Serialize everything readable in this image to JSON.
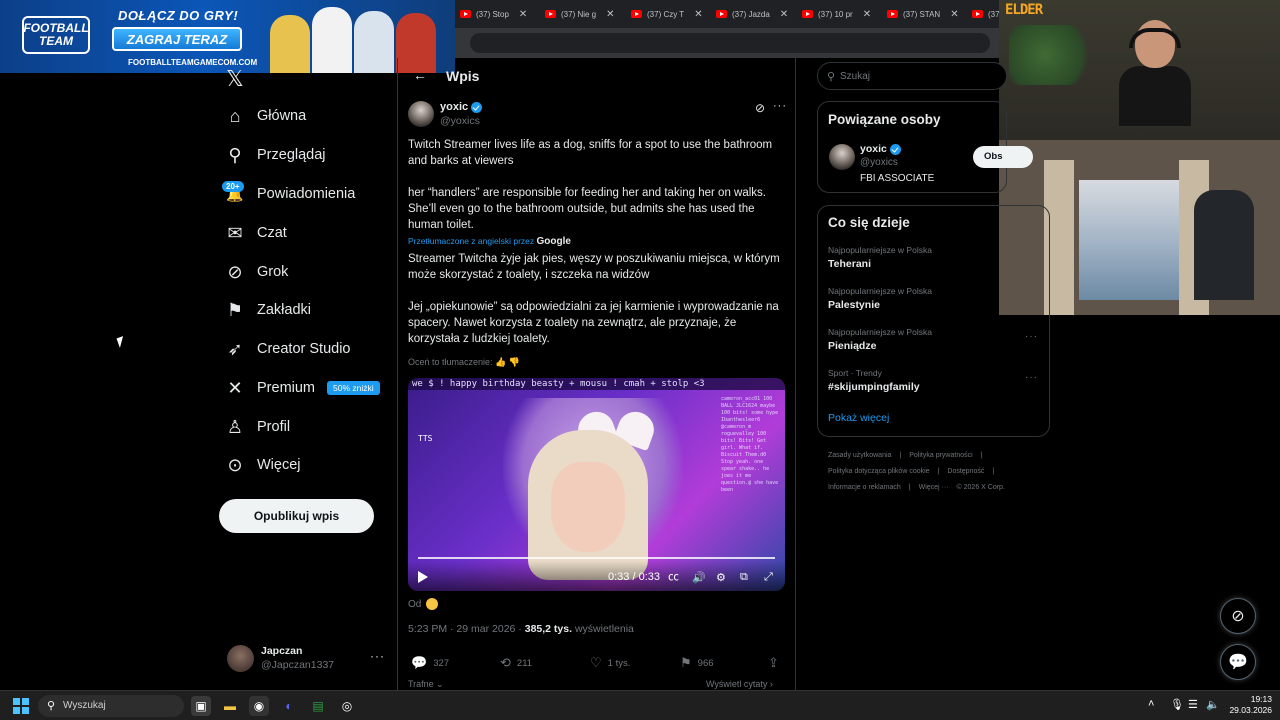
{
  "browser": {
    "tabs": [
      "(37) Stop",
      "(37) Nie g",
      "(37) Czy T",
      "(37) Jazda",
      "(37) 10 pr",
      "(37) STAN",
      "(37)"
    ]
  },
  "ad": {
    "logo_line1": "FOOTBALL",
    "logo_line2": "TEAM",
    "headline": "DOŁĄCZ DO GRY!",
    "cta": "ZAGRAJ TERAZ",
    "site": "FOOTBALLTEAMGAMECOM.COM"
  },
  "webcam": {
    "tag": "ELDER"
  },
  "nav": {
    "logo": "𝕏",
    "items": [
      {
        "label": "Główna",
        "icon": "home-icon",
        "glyph": "⌂"
      },
      {
        "label": "Przeglądaj",
        "icon": "search-icon",
        "glyph": "⚲"
      },
      {
        "label": "Powiadomienia",
        "icon": "bell-icon",
        "glyph": "🔔"
      },
      {
        "label": "Czat",
        "icon": "mail-icon",
        "glyph": "✉"
      },
      {
        "label": "Grok",
        "icon": "grok-icon",
        "glyph": "⊘"
      },
      {
        "label": "Zakładki",
        "icon": "bookmark-icon",
        "glyph": "⚑"
      },
      {
        "label": "Creator Studio",
        "icon": "rocket-icon",
        "glyph": "➶"
      },
      {
        "label": "Premium",
        "icon": "x-premium-icon",
        "glyph": "✕"
      },
      {
        "label": "Profil",
        "icon": "person-icon",
        "glyph": "♙"
      },
      {
        "label": "Więcej",
        "icon": "more-circle-icon",
        "glyph": "⊙"
      }
    ],
    "notif_badge": "20+",
    "premium_badge": "50% zniżki",
    "post_button": "Opublikuj wpis",
    "account": {
      "name": "Japczan",
      "handle": "@Japczan1337",
      "more": "···"
    }
  },
  "post": {
    "back": "←",
    "header": "Wpis",
    "author": {
      "name": "yoxic",
      "handle": "@yoxics"
    },
    "original_p1": "Twitch Streamer lives life as a dog, sniffs for a spot to use the bathroom and barks at viewers",
    "original_p2": "her “handlers” are responsible for feeding her and taking her on walks. She’ll even go to the bathroom outside, but admits she has used the human toilet.",
    "translated_by": "Przetłumaczone z angielski przez",
    "translator": "Google",
    "translated_p1": "Streamer Twitcha żyje jak pies, węszy w poszukiwaniu miejsca, w którym może skorzystać z toalety, i szczeka na widzów",
    "translated_p2": "Jej „opiekunowie” są odpowiedzialni za jej karmienie i wyprowadzanie na spacery. Nawet korzysta z toalety na zewnątrz, ale przyznaje, że korzystała z ludzkiej toalety.",
    "rate_translation": "Oceń to tłumaczenie:",
    "video": {
      "ticker": "we $ ! happy birthday beasty + mousu ! cmah + stolp <3",
      "tts": "TTS",
      "chat": "cameron_acc01 100 BALL JLC1624 maybe 100 bits! some hype Ibanthesleer6 @cameron_m roguevalley 100 bits! Bits! Get girl. What if. Biscuit Them.d0 Stop yeah. one spear shake.. he joes it me question.@ she have been",
      "time": "0:33 / 0:33"
    },
    "from_label": "Od",
    "time": "5:23 PM · 29 mar 2026 ·",
    "views_value": "385,2 tys.",
    "views_label": "wyświetlenia",
    "replies": "327",
    "reposts": "211",
    "likes": "1 tys.",
    "bookmarks": "966",
    "sort_label": "Trafne ⌄",
    "view_quotes": "Wyświetl cytaty ›"
  },
  "sidebar": {
    "search_placeholder": "Szukaj",
    "related": {
      "title": "Powiązane osoby",
      "name": "yoxic",
      "handle": "@yoxics",
      "bio": "FBI ASSOCIATE",
      "follow": "Obs"
    },
    "trends": {
      "title": "Co się dzieje",
      "items": [
        {
          "context": "Najpopularniejsze w Polska",
          "name": "Teherani"
        },
        {
          "context": "Najpopularniejsze w Polska",
          "name": "Palestynie"
        },
        {
          "context": "Najpopularniejsze w Polska",
          "name": "Pieniądze"
        },
        {
          "context": "Sport · Trendy",
          "name": "#skijumpingfamily"
        }
      ],
      "show_more": "Pokaż więcej"
    },
    "footer": [
      [
        "Zasady użytkowania",
        "|",
        "Polityka prywatności",
        "|"
      ],
      [
        "Polityka dotycząca plików cookie",
        "|",
        "Dostępność",
        "|"
      ],
      [
        "Informacje o reklamach",
        "|",
        "Więcej ···",
        "© 2026 X Corp."
      ]
    ]
  },
  "taskbar": {
    "search_placeholder": "Wyszukaj",
    "time": "19:13",
    "date": "29.03.2026"
  }
}
